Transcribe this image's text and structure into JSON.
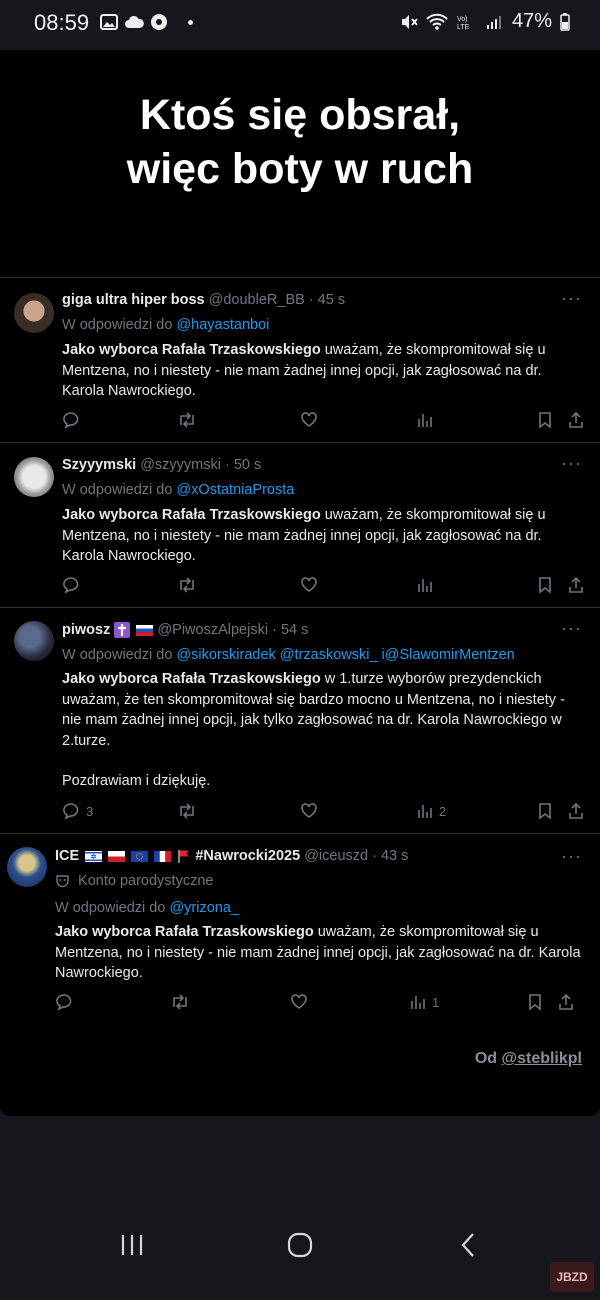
{
  "status_bar": {
    "time": "08:59",
    "battery": "47%"
  },
  "headline": {
    "line1": "Ktoś się obsrał,",
    "line2": "więc boty w ruch"
  },
  "tweets": [
    {
      "name": "giga ultra hiper boss",
      "handle": "@doubleR_BB",
      "time": "· 45 s",
      "reply_prefix": "W odpowiedzi do",
      "reply_to": "@hayastanboi",
      "bold": "Jako wyborca Rafała Trzaskowskiego",
      "text": " uważam, że skompromitował się u Mentzena, no i niestety - nie mam żadnej innej opcji, jak zagłosować na dr. Karola Nawrockiego."
    },
    {
      "name": "Szyyymski",
      "handle": "@szyyymski",
      "time": "· 50 s",
      "reply_prefix": "W odpowiedzi do",
      "reply_to": "@xOstatniaProsta",
      "bold": "Jako wyborca Rafała Trzaskowskiego",
      "text": " uważam, że skompromitował się u Mentzena, no i niestety - nie mam żadnej innej opcji, jak zagłosować na dr. Karola Nawrockiego."
    },
    {
      "name": "piwosz",
      "handle": "@PiwoszAlpejski",
      "time": "· 54 s",
      "reply_prefix": "W odpowiedzi do",
      "reply_to": "@sikorskiradek @trzaskowski_ i@SlawomirMentzen",
      "bold": "Jako wyborca Rafała Trzaskowskiego",
      "text": " w 1.turze wyborów prezydenckich uważam, że ten skompromitował się bardzo mocno u Mentzena, no i niestety - nie mam żadnej innej opcji, jak tylko zagłosować na dr. Karola Nawrockiego w 2.turze.",
      "text2": "Pozdrawiam i dziękuję.",
      "replies": "3",
      "views": "2"
    },
    {
      "name": "ICE",
      "name_tag": "#Nawrocki2025",
      "handle": "@iceuszd",
      "time": "· 43 s",
      "parody": "Konto parodystyczne",
      "reply_prefix": "W odpowiedzi do",
      "reply_to": "@yrizona_",
      "bold": "Jako wyborca Rafała Trzaskowskiego",
      "text": " uważam, że skompromitował się u Mentzena, no i niestety - nie mam żadnej innej opcji, jak zagłosować na dr. Karola Nawrockiego.",
      "views": "1"
    }
  ],
  "credit": {
    "prefix": "Od ",
    "handle": "@steblikpl"
  },
  "watermark": "JBZD",
  "icons": {
    "reply": "speech-bubble-icon",
    "repost": "repost-arrows-icon",
    "like": "heart-icon",
    "views": "bar-chart-icon",
    "bookmark": "bookmark-icon",
    "share": "share-icon",
    "more": "ellipsis-icon"
  },
  "colors": {
    "link": "#1d9bf0",
    "muted": "#71767b",
    "background": "#000000"
  }
}
